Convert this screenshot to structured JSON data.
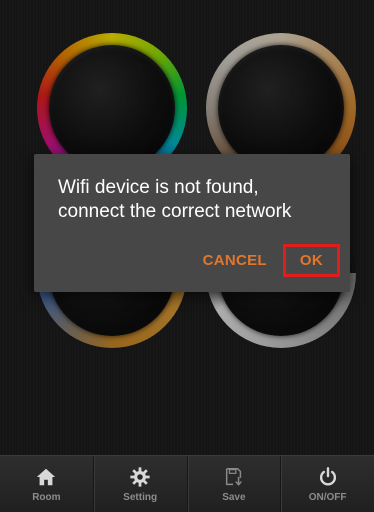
{
  "dialog": {
    "message_line1": "Wifi device is not found,",
    "message_line2": "connect the correct network",
    "cancel_label": "CANCEL",
    "ok_label": "OK"
  },
  "tabbar": {
    "items": [
      {
        "label": "Room",
        "icon": "home-icon"
      },
      {
        "label": "Setting",
        "icon": "gear-icon"
      },
      {
        "label": "Save",
        "icon": "save-icon"
      },
      {
        "label": "ON/OFF",
        "icon": "power-icon"
      }
    ]
  },
  "colors": {
    "accent": "#e0772f",
    "highlight_border": "#e21b1b",
    "dialog_bg": "#474747"
  }
}
